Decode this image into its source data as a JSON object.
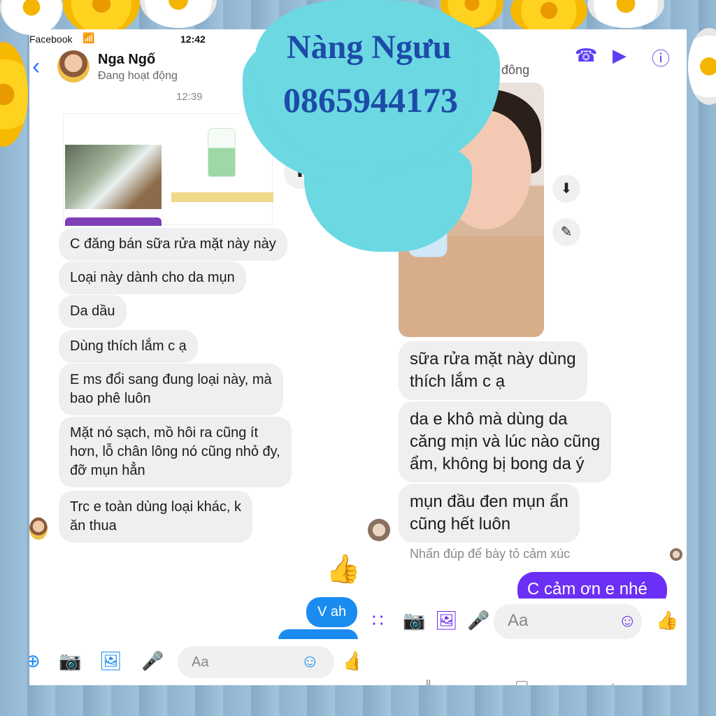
{
  "left": {
    "statusbar": {
      "carrier": "Facebook",
      "time": "12:42"
    },
    "contact": {
      "name": "Nga Ngố",
      "status": "Đang hoạt động"
    },
    "timestamp": "12:39",
    "messages": [
      "C đăng bán sữa rửa mặt này này",
      "Loại này dành cho da mụn",
      "Da dầu",
      "Dùng thích lắm c ạ",
      "E ms đổi sang đung loại này, mà\nbao phê luôn",
      "Mặt nó sạch, mồ hôi ra cũng ít\nhơn, lỗ chân lông nó cũng nhỏ đy,\nđỡ mụn hẳn",
      "Trc e toàn dùng loại khác, k\năn thua"
    ],
    "sent": [
      "V ah"
    ],
    "composer_placeholder": "Aa"
  },
  "right": {
    "status_partial": "g hoạt đông",
    "messages": [
      "sữa rửa mặt này dùng\nthích lắm c ạ",
      "da e khô mà dùng da\ncăng mịn và lúc nào cũng\nẩm, không bị bong da ý",
      "mụn đầu đen mụn ẩn\ncũng hết luôn"
    ],
    "reaction_hint": "Nhấn đúp để bày tỏ cảm xúc",
    "sent": "C cảm ơn e nhé",
    "composer_placeholder": "Aa"
  },
  "overlay": {
    "name": "Nàng Ngưu",
    "phone": "0865944173"
  },
  "colors": {
    "messenger_blue": "#1a8cf0",
    "messenger_purple": "#6b2ff5",
    "overlay_cloud": "#6bd8e2",
    "overlay_text": "#1d4ba8"
  }
}
